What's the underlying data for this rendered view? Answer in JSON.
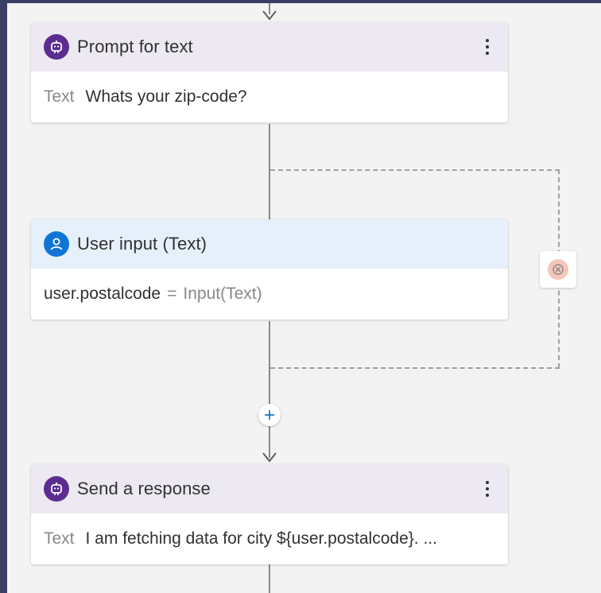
{
  "canvas": {
    "colors": {
      "frame": "#3b3f66",
      "canvas": "#f3f3f3",
      "purple_accent": "#5c2d91",
      "blue_accent": "#1074d6",
      "cancel_bg": "#f4c7b8"
    }
  },
  "nodes": {
    "prompt": {
      "icon": "bot-icon",
      "title": "Prompt for text",
      "field_label": "Text",
      "field_value": "Whats your zip-code?"
    },
    "user_input": {
      "icon": "person-icon",
      "title": "User input (Text)",
      "variable": "user.postalcode",
      "operator": "=",
      "expression": "Input(Text)"
    },
    "response": {
      "icon": "bot-icon",
      "title": "Send a response",
      "field_label": "Text",
      "field_value": "I am fetching data for city ${user.postalcode}. ..."
    }
  },
  "controls": {
    "add_step_icon": "plus-icon",
    "cancel_branch_icon": "cancel-circle-icon",
    "more_options_icon": "more-vertical-icon"
  }
}
